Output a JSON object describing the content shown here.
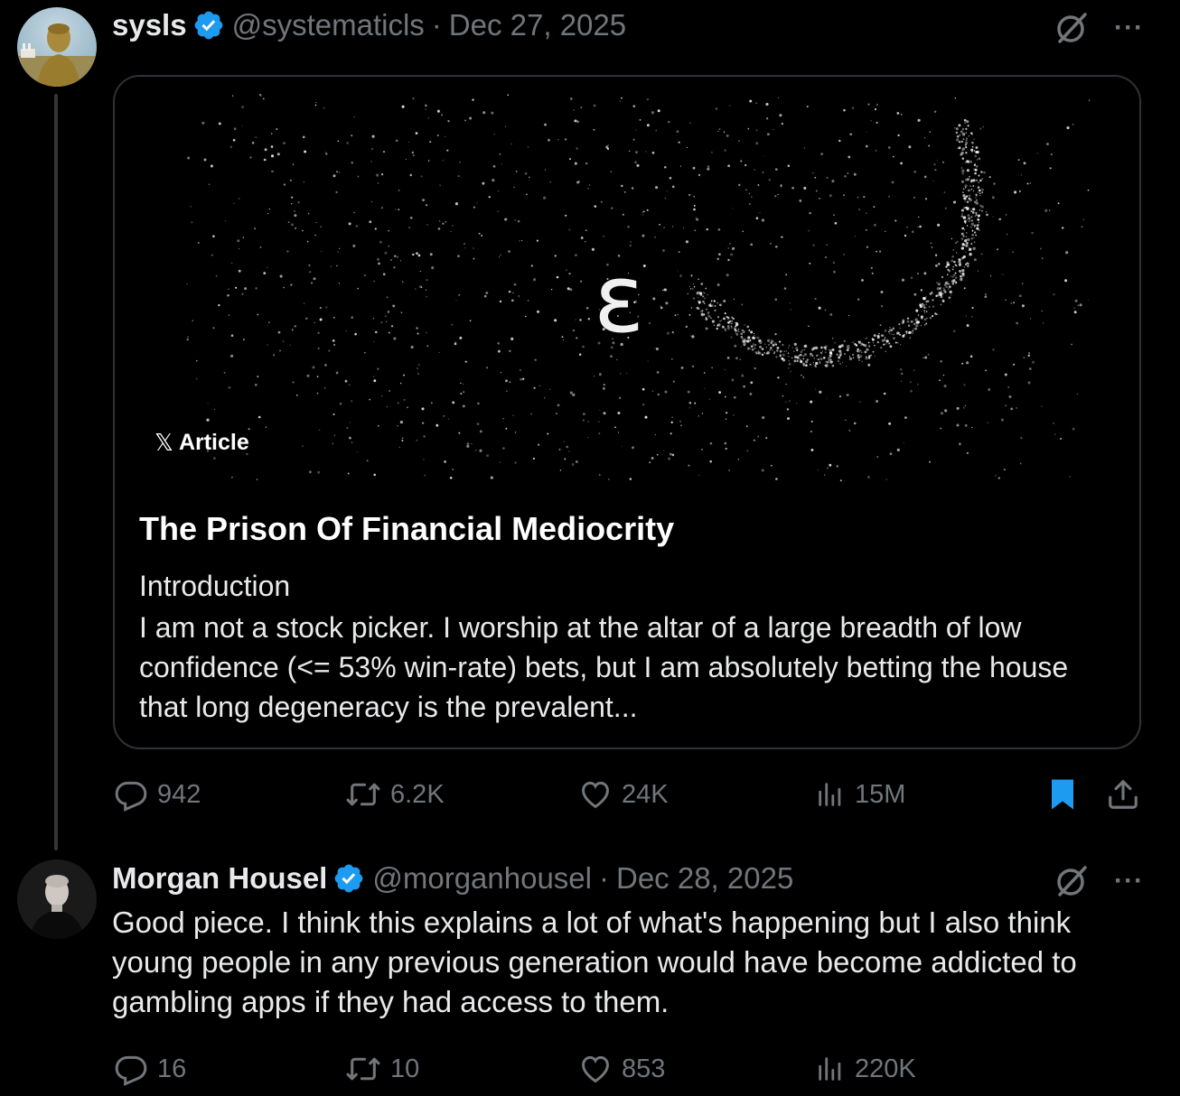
{
  "tweet1": {
    "display_name": "sysls",
    "handle": "@systematicls",
    "separator": "·",
    "date": "Dec 27, 2025",
    "article": {
      "badge": "Article",
      "logo_char": "𝕏",
      "cover_symbol": "ε",
      "title": "The Prison Of Financial Mediocrity",
      "subhead": "Introduction",
      "excerpt": "I am not a stock picker. I worship at the altar of a large breadth of low confidence (<= 53% win-rate) bets, but I am absolutely betting the house that long degeneracy is the prevalent..."
    },
    "stats": {
      "replies": "942",
      "reposts": "6.2K",
      "likes": "24K",
      "views": "15M"
    },
    "bookmarked": true
  },
  "tweet2": {
    "display_name": "Morgan Housel",
    "handle": "@morganhousel",
    "separator": "·",
    "date": "Dec 28, 2025",
    "text": "Good piece. I think this explains a lot of what's happening but I also think young people in any previous generation would have become addicted to gambling apps if they had access to them.",
    "stats": {
      "replies": "16",
      "reposts": "10",
      "likes": "853",
      "views": "220K"
    }
  },
  "icons": {
    "verified": "verified-badge-icon",
    "grok": "grok-icon",
    "more": "more-icon",
    "reply": "reply-icon",
    "repost": "repost-icon",
    "like": "like-icon",
    "views": "views-icon",
    "bookmark": "bookmark-icon",
    "share": "share-icon"
  },
  "colors": {
    "background": "#000000",
    "text": "#e7e9ea",
    "secondary": "#71767b",
    "verified": "#1d9bf0",
    "bookmark": "#1d9bf0",
    "border": "#2f3336"
  },
  "more_glyph": "···"
}
